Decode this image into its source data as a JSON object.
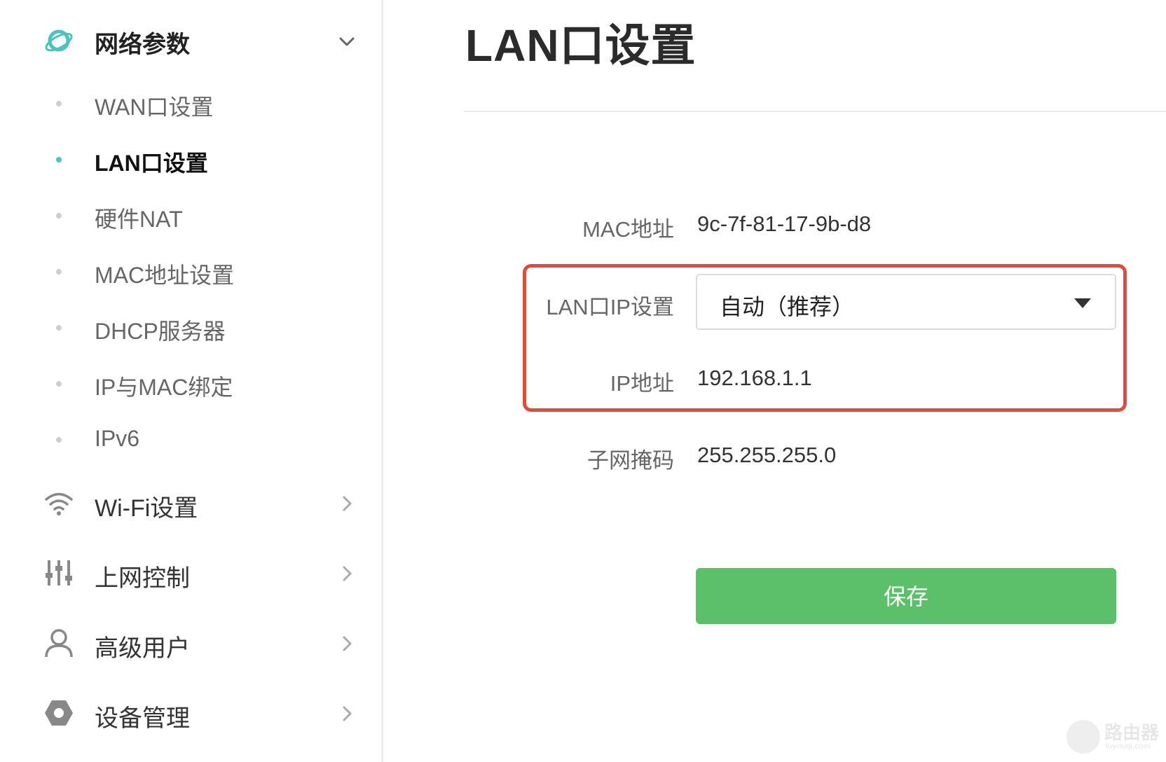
{
  "sidebar": {
    "network_group": {
      "label": "网络参数",
      "icon": "planet-icon",
      "expanded": true,
      "items": [
        {
          "label": "WAN口设置",
          "active": false
        },
        {
          "label": "LAN口设置",
          "active": true
        },
        {
          "label": "硬件NAT",
          "active": false
        },
        {
          "label": "MAC地址设置",
          "active": false
        },
        {
          "label": "DHCP服务器",
          "active": false
        },
        {
          "label": "IP与MAC绑定",
          "active": false
        },
        {
          "label": "IPv6",
          "active": false
        }
      ]
    },
    "groups": [
      {
        "label": "Wi-Fi设置",
        "icon": "wifi-icon"
      },
      {
        "label": "上网控制",
        "icon": "sliders-icon"
      },
      {
        "label": "高级用户",
        "icon": "user-icon"
      },
      {
        "label": "设备管理",
        "icon": "hexagon-icon"
      }
    ],
    "accent_color": "#4cc3bf"
  },
  "main": {
    "title": "LAN口设置",
    "fields": {
      "mac_label": "MAC地址",
      "mac_value": "9c-7f-81-17-9b-d8",
      "lan_ip_mode_label": "LAN口IP设置",
      "lan_ip_mode_value": "自动（推荐）",
      "ip_label": "IP地址",
      "ip_value": "192.168.1.1",
      "subnet_label": "子网掩码",
      "subnet_value": "255.255.255.0"
    },
    "save_label": "保存",
    "save_color": "#5cbf6a",
    "highlight_color": "#e14b3b"
  },
  "watermark": {
    "text": "路由器",
    "sub": "luyouqi.com"
  }
}
